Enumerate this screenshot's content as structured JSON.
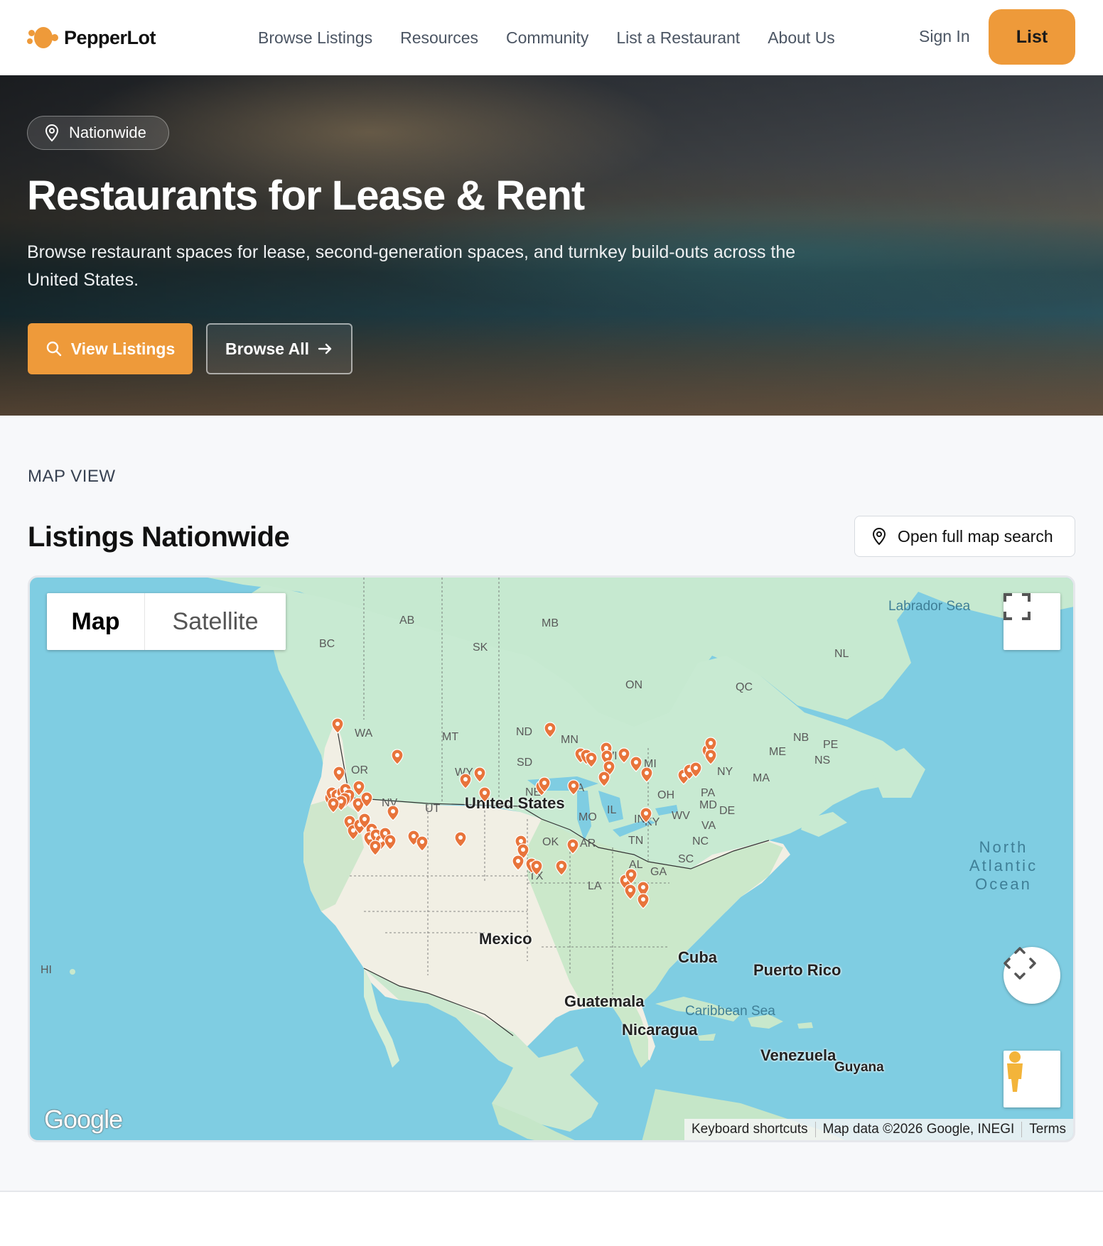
{
  "brand": {
    "name": "PepperLot",
    "accent": "#ee9a3a"
  },
  "nav": {
    "items": [
      "Browse Listings",
      "Resources",
      "Community",
      "List a Restaurant",
      "About Us"
    ],
    "sign_in": "Sign In",
    "list_button": "List"
  },
  "hero": {
    "badge": "Nationwide",
    "badge_icon": "map-pin-icon",
    "title": "Restaurants for Lease & Rent",
    "description": "Browse restaurant spaces for lease, second-generation spaces, and turnkey build-outs across the United States.",
    "primary_button": "View Listings",
    "primary_icon": "search-icon",
    "secondary_button": "Browse All",
    "secondary_icon": "arrow-right-icon"
  },
  "map_section": {
    "eyebrow": "MAP VIEW",
    "title": "Listings Nationwide",
    "open_map_button": "Open full map search",
    "open_map_icon": "map-pin-icon"
  },
  "map": {
    "type_options": [
      "Map",
      "Satellite"
    ],
    "selected_type": "Map",
    "countries": [
      "United States",
      "Mexico",
      "Cuba",
      "Puerto Rico",
      "Guatemala",
      "Nicaragua",
      "Venezuela",
      "Guyana"
    ],
    "state_labels": [
      "AB",
      "BC",
      "SK",
      "MB",
      "ON",
      "QC",
      "NL",
      "NB",
      "PE",
      "NS",
      "WA",
      "OR",
      "MT",
      "ND",
      "SD",
      "WY",
      "NE",
      "UT",
      "NV",
      "MN",
      "WI",
      "IA",
      "IL",
      "IN",
      "MI",
      "OH",
      "NY",
      "PA",
      "MD",
      "DE",
      "VA",
      "WV",
      "KY",
      "MO",
      "TN",
      "AR",
      "OK",
      "TX",
      "LA",
      "AL",
      "GA",
      "SC",
      "NC",
      "ME",
      "MA",
      "HI"
    ],
    "seas": [
      "Labrador Sea",
      "Caribbean Sea"
    ],
    "ocean": "North Atlantic Ocean",
    "attribution": {
      "shortcuts": "Keyboard shortcuts",
      "data": "Map data ©2026 Google, INEGI",
      "terms": "Terms"
    },
    "logo": "Google",
    "marker_color": "#e8743b"
  }
}
